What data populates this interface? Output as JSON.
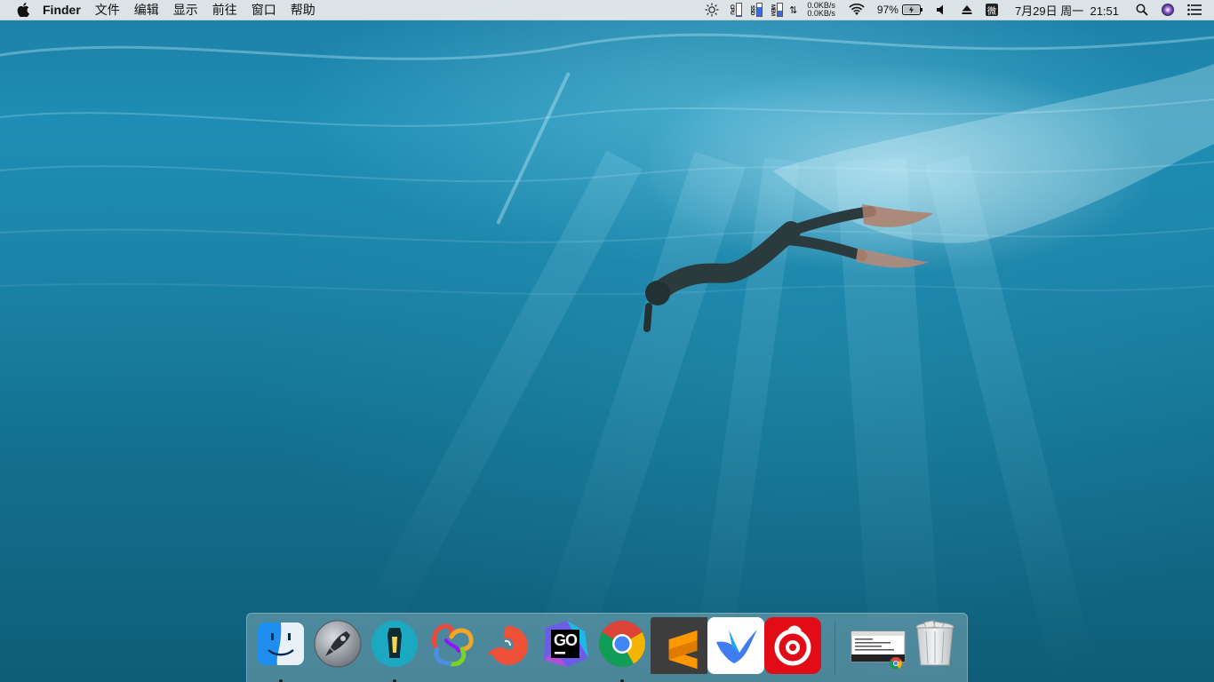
{
  "menubar": {
    "app_name": "Finder",
    "menus": [
      "文件",
      "编辑",
      "显示",
      "前往",
      "窗口",
      "帮助"
    ],
    "status": {
      "brightness_icon": "sun-icon",
      "cpu_label": "CPU",
      "ssd_label": "SSD",
      "mem_label": "MEM",
      "net_up": "0.0KB/s",
      "net_down": "0.0KB/s",
      "wifi_icon": "wifi-icon",
      "battery_percent": "97%",
      "battery_level": 0.97,
      "volume_icon": "speaker-icon",
      "eject_icon": "eject-icon",
      "wechat_label": "微",
      "datetime": "7月29日 周一  21:51",
      "search_icon": "spotlight-icon",
      "siri_icon": "siri-icon",
      "notification_icon": "notification-center-icon"
    }
  },
  "dock": {
    "apps": [
      {
        "name": "Finder",
        "icon": "finder-icon",
        "running": true
      },
      {
        "name": "Launchpad",
        "icon": "launchpad-icon",
        "running": false
      },
      {
        "name": "Lantern",
        "icon": "lantern-icon",
        "running": true
      },
      {
        "name": "Navicat",
        "icon": "navicat-icon",
        "running": false
      },
      {
        "name": "Swift",
        "icon": "swift-icon",
        "running": false
      },
      {
        "name": "GoLand",
        "icon": "goland-icon",
        "running": false
      },
      {
        "name": "Google Chrome",
        "icon": "chrome-icon",
        "running": true
      },
      {
        "name": "Sublime Text",
        "icon": "sublime-icon",
        "running": false
      },
      {
        "name": "Feishu",
        "icon": "feishu-icon",
        "running": false
      },
      {
        "name": "NetEase Music",
        "icon": "netease-music-icon",
        "running": false
      }
    ],
    "goland_label": "GO",
    "trash_icon": "trash-icon",
    "minimized_window_icon": "chrome-minimized-window-icon"
  },
  "colors": {
    "menubar_bg": "#ececec",
    "ocean_top": "#1f8db3",
    "ocean_bottom": "#0f5d78"
  }
}
